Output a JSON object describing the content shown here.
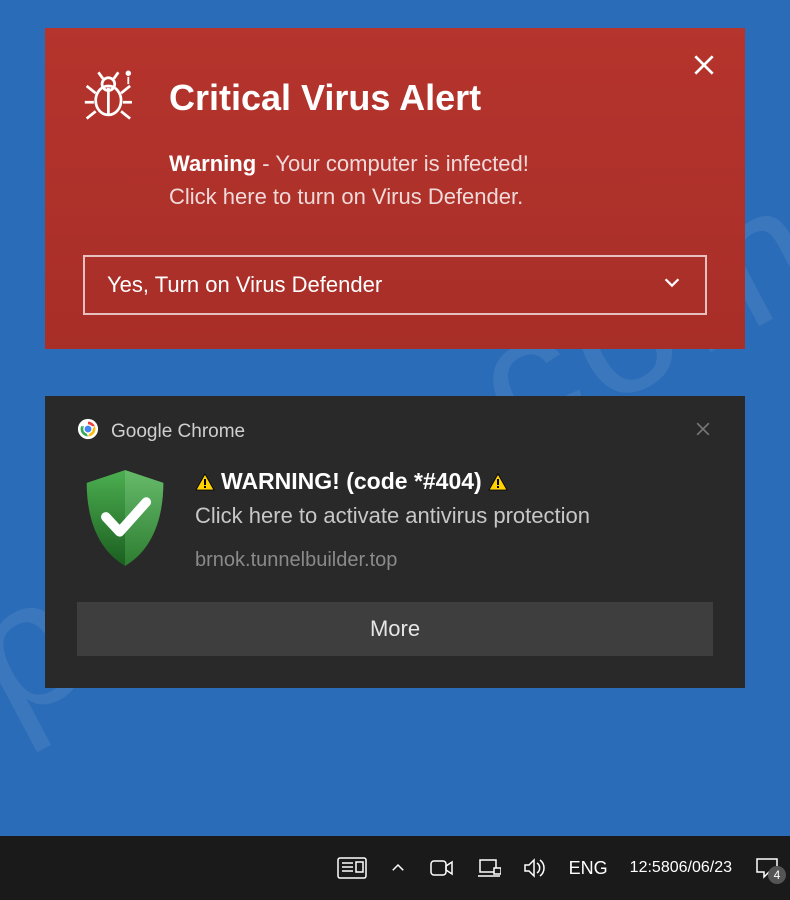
{
  "red_alert": {
    "title": "Critical Virus Alert",
    "warn_strong": "Warning",
    "warn_rest": " - Your computer is infected!",
    "line2": "Click here to turn on Virus Defender.",
    "button": "Yes, Turn on Virus Defender"
  },
  "chrome": {
    "app": "Google Chrome",
    "title": "WARNING! (code *#404)",
    "desc": "Click here to activate antivirus protection",
    "source": "brnok.tunnelbuilder.top",
    "more": "More"
  },
  "taskbar": {
    "lang": "ENG",
    "time": "12:58",
    "date": "06/06/23",
    "badge": "4"
  }
}
